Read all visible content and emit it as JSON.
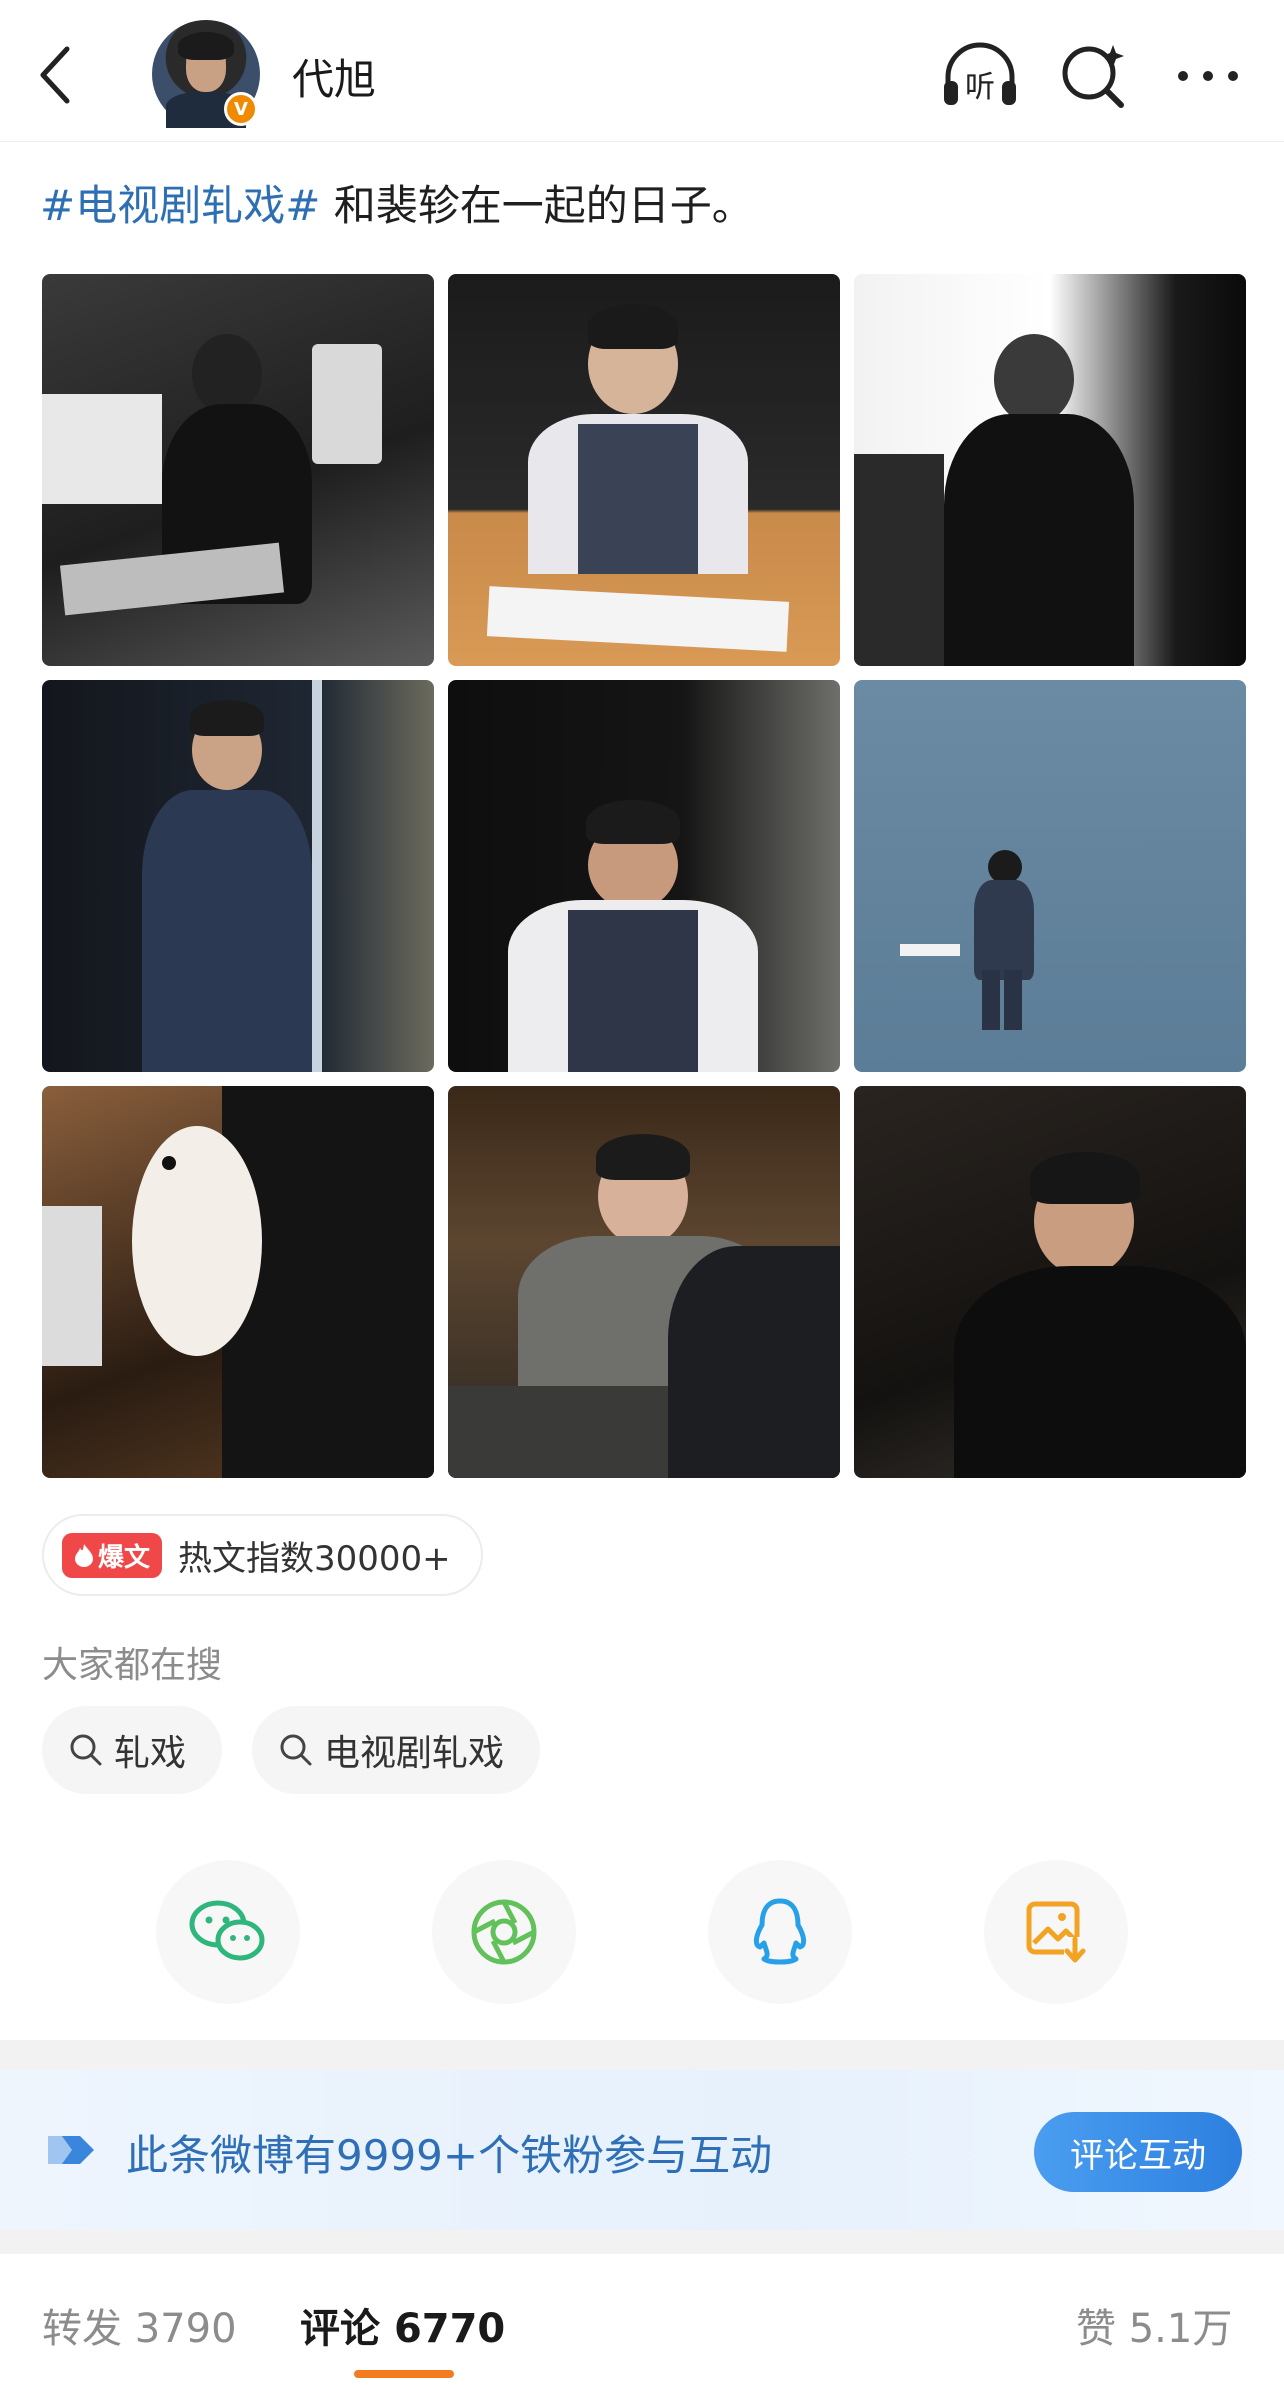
{
  "header": {
    "username": "代旭",
    "verified_badge": "V",
    "icons": [
      "back-icon",
      "listen-icon",
      "search-sparkle-icon",
      "more-icon"
    ],
    "listen_label": "听"
  },
  "post": {
    "hashtag": "#电视剧轧戏#",
    "text": " 和裴轸在一起的日子。",
    "photo_count": 9
  },
  "hot": {
    "badge": "爆文",
    "text": "热文指数30000+"
  },
  "search": {
    "label": "大家都在搜",
    "chips": [
      "轧戏",
      "电视剧轧戏"
    ]
  },
  "share": {
    "items": [
      "wechat-icon",
      "moments-icon",
      "qq-icon",
      "save-image-icon"
    ]
  },
  "banner": {
    "text": "此条微博有9999+个铁粉参与互动",
    "button": "评论互动"
  },
  "tabs": {
    "repost_label": "转发",
    "repost_count": "3790",
    "comment_label": "评论",
    "comment_count": "6770",
    "like_label": "赞",
    "like_count": "5.1万"
  },
  "colors": {
    "link": "#2e6fb4",
    "accent": "#f47b20",
    "hot": "#f04848",
    "banner_button": "#2d7fdf"
  }
}
